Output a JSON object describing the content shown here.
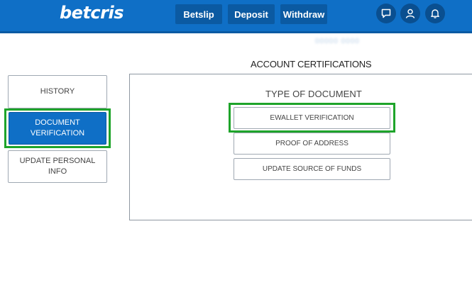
{
  "header": {
    "logo": "betcris",
    "nav": {
      "betslip": "Betslip",
      "deposit": "Deposit",
      "withdraw": "Withdraw"
    },
    "icons": [
      "chat-icon",
      "user-icon",
      "bell-icon"
    ],
    "colors": {
      "bar": "#0f6fc6",
      "button": "#0b5aa2"
    }
  },
  "account": {
    "id_blurred": "00000 0000"
  },
  "page": {
    "title": "ACCOUNT CERTIFICATIONS"
  },
  "sidebar": {
    "items": [
      {
        "label": "HISTORY"
      },
      {
        "label": "DOCUMENT\nVERIFICATION",
        "active": true
      },
      {
        "label": "UPDATE PERSONAL\nINFO"
      }
    ]
  },
  "documents": {
    "heading": "TYPE OF DOCUMENT",
    "options": [
      {
        "label": "EWALLET VERIFICATION",
        "highlighted": true
      },
      {
        "label": "PROOF OF ADDRESS"
      },
      {
        "label": "UPDATE SOURCE OF FUNDS"
      }
    ]
  },
  "highlight_color": "#1ea42a"
}
